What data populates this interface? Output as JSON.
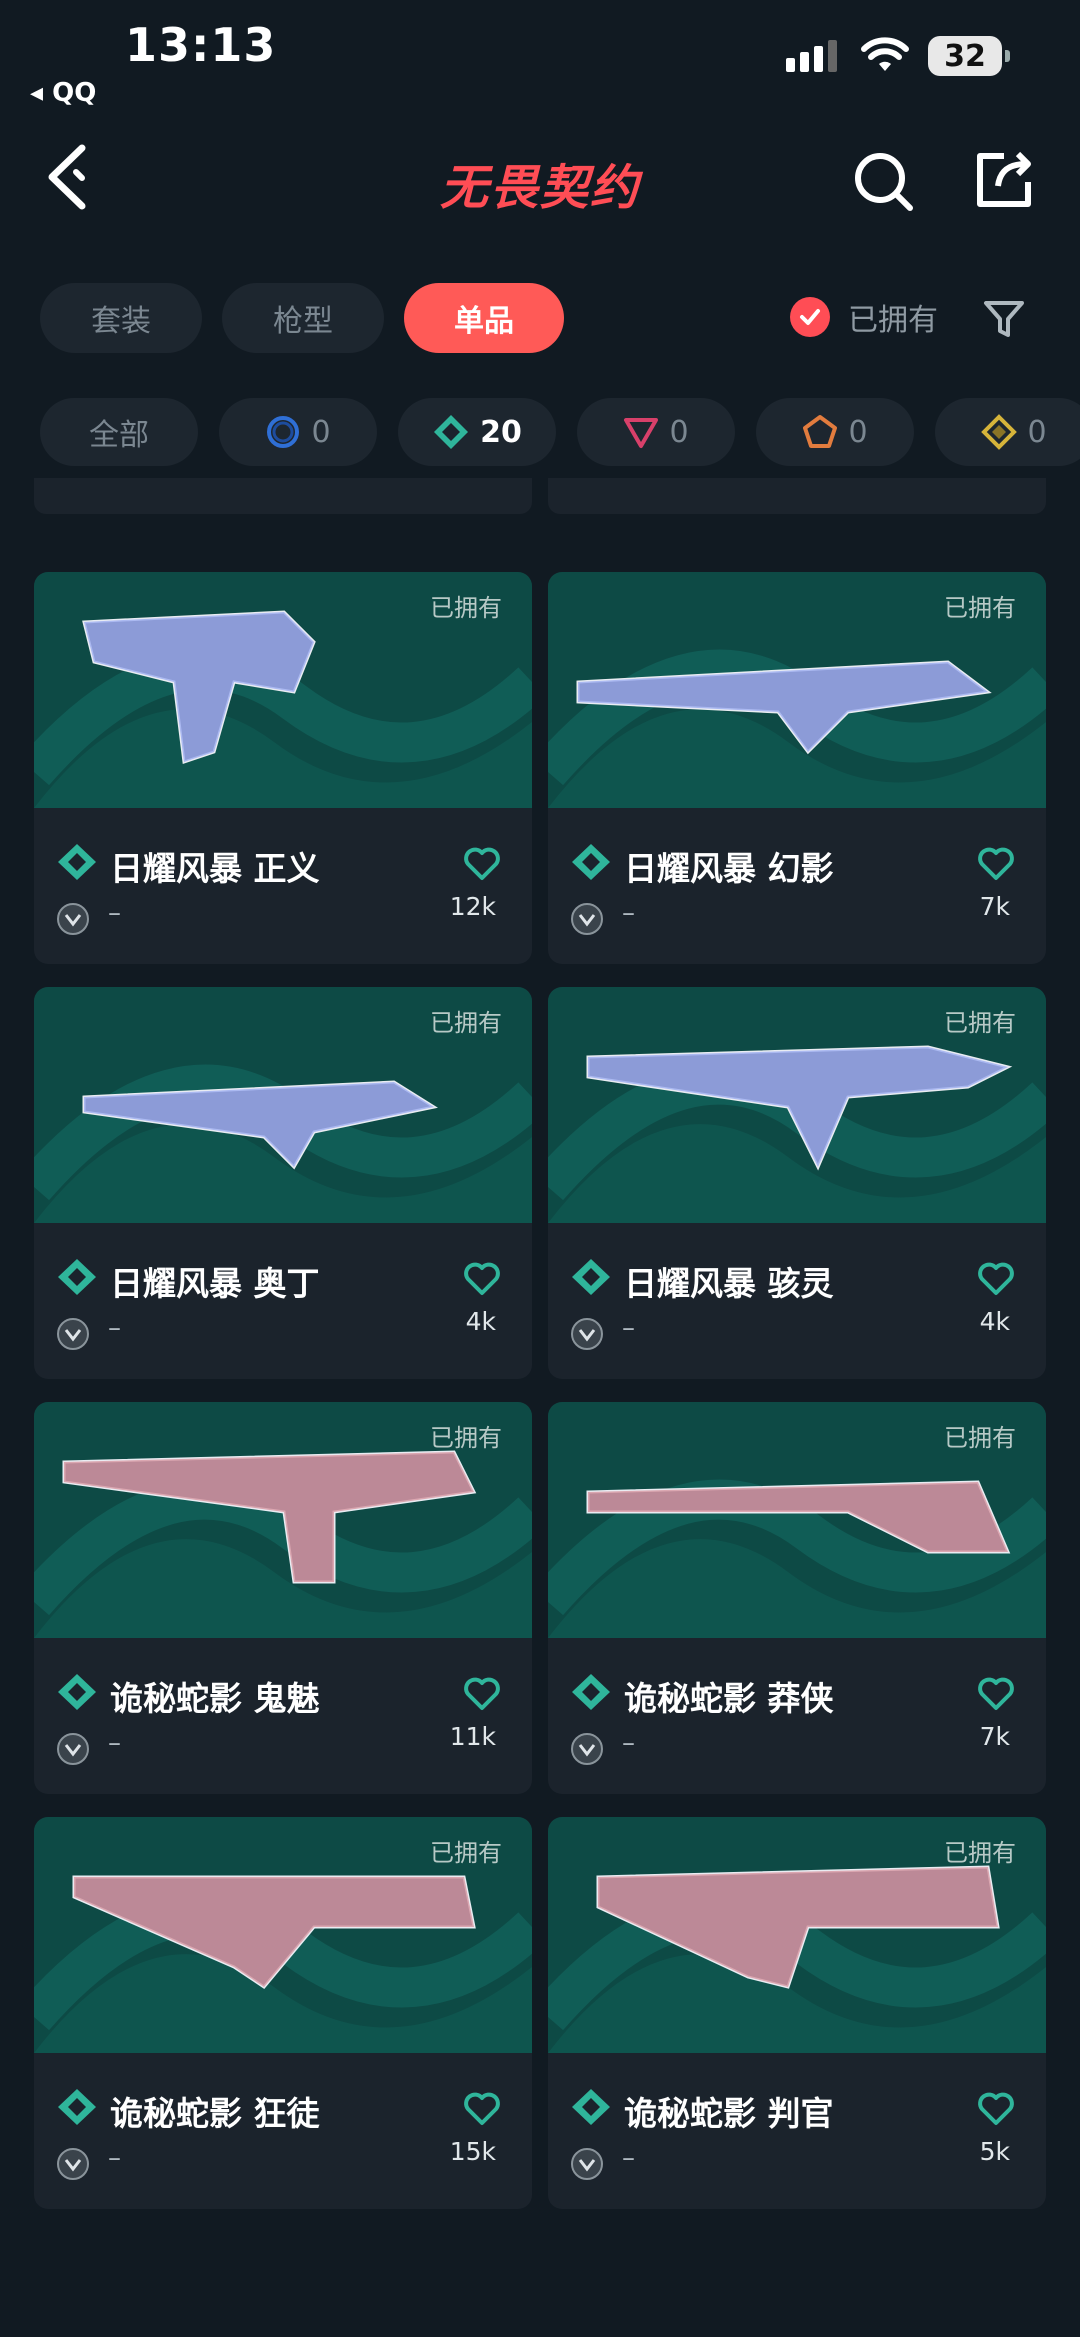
{
  "status_bar": {
    "time": "13:13",
    "back_app": "◂ QQ",
    "battery": "32"
  },
  "header": {
    "title": "无畏契约"
  },
  "tabs": [
    {
      "label": "套装",
      "active": false
    },
    {
      "label": "枪型",
      "active": false
    },
    {
      "label": "单品",
      "active": true
    }
  ],
  "owned_filter": {
    "label": "已拥有",
    "checked": true
  },
  "tiers": [
    {
      "label": "全部"
    },
    {
      "count": "0",
      "color": "#2f6fd6"
    },
    {
      "count": "20",
      "color": "#2fb59b"
    },
    {
      "count": "0",
      "color": "#d8406a"
    },
    {
      "count": "0",
      "color": "#e27c3e"
    },
    {
      "count": "0",
      "color": "#d6b43a"
    }
  ],
  "items": [
    {
      "name": "日耀风暴 正义",
      "owned": "已拥有",
      "grade": "–",
      "likes": "12k",
      "theme": "blue"
    },
    {
      "name": "日耀风暴 幻影",
      "owned": "已拥有",
      "grade": "–",
      "likes": "7k",
      "theme": "blue"
    },
    {
      "name": "日耀风暴 奥丁",
      "owned": "已拥有",
      "grade": "–",
      "likes": "4k",
      "theme": "blue"
    },
    {
      "name": "日耀风暴 骇灵",
      "owned": "已拥有",
      "grade": "–",
      "likes": "4k",
      "theme": "blue"
    },
    {
      "name": "诡秘蛇影 鬼魅",
      "owned": "已拥有",
      "grade": "–",
      "likes": "11k",
      "theme": "red"
    },
    {
      "name": "诡秘蛇影 莽侠",
      "owned": "已拥有",
      "grade": "–",
      "likes": "7k",
      "theme": "red"
    },
    {
      "name": "诡秘蛇影 狂徒",
      "owned": "已拥有",
      "grade": "–",
      "likes": "15k",
      "theme": "red"
    },
    {
      "name": "诡秘蛇影 判官",
      "owned": "已拥有",
      "grade": "–",
      "likes": "5k",
      "theme": "red"
    }
  ]
}
